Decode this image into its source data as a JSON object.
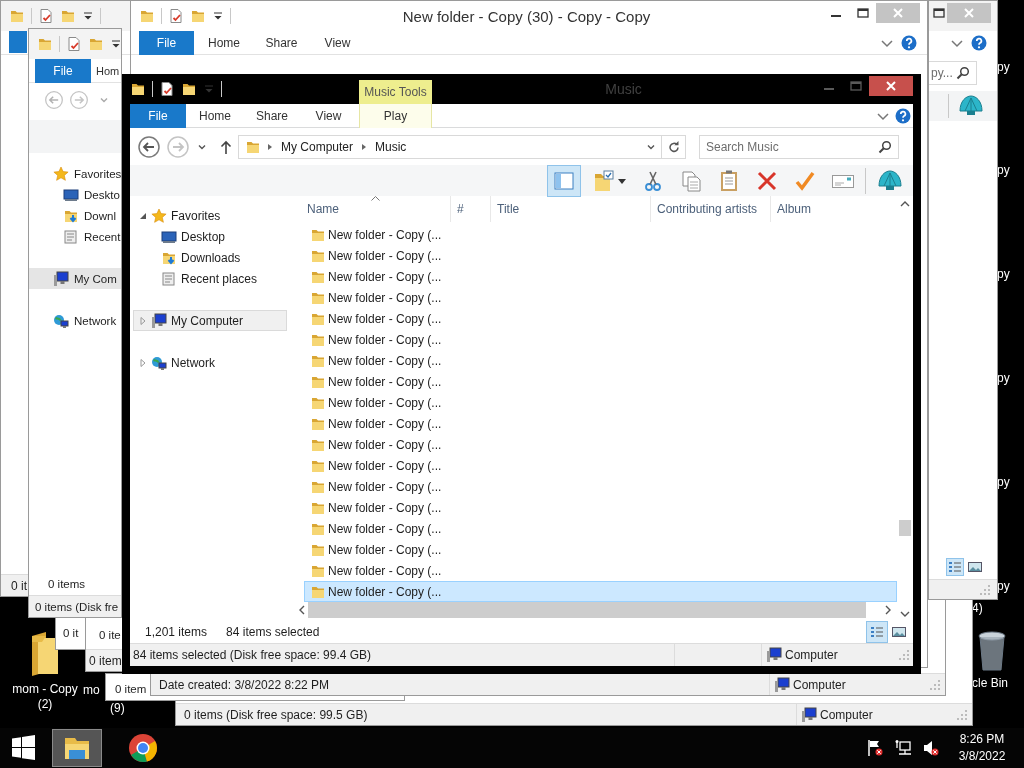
{
  "background_windows": [
    {
      "kind": "strip",
      "status": "0 it"
    },
    {
      "kind": "footer",
      "status": "0 items (Disk free space: 99.5 GB)",
      "location": "Computer"
    },
    {
      "kind": "footer",
      "body_text": "0 it"
    },
    {
      "kind": "footer",
      "body_text": "0 ite",
      "status": "0 item"
    },
    {
      "kind": "footer",
      "body_text": "0 item"
    },
    {
      "kind": "footer",
      "status": "Date created: 3/8/2022 8:22 PM",
      "location": "Computer"
    },
    {
      "kind": "explorer",
      "tabs": [
        "File",
        "Hom"
      ],
      "nav": [
        {
          "kind": "favorites",
          "label": "Favorites",
          "selected": false,
          "children": [
            {
              "kind": "desktop",
              "label": "Deskto",
              "selected": false
            },
            {
              "kind": "downloads",
              "label": "Downl",
              "selected": false
            },
            {
              "kind": "recent",
              "label": "Recent",
              "selected": false
            }
          ]
        },
        {
          "kind": "computer",
          "label": "My Com",
          "selected": true
        },
        {
          "kind": "network",
          "label": "Network",
          "selected": false
        }
      ],
      "count": "0 items",
      "status": "0 items (Disk fre"
    },
    {
      "kind": "edge",
      "search_placeholder": "py..."
    },
    {
      "kind": "titled",
      "title": "New folder - Copy (30) - Copy - Copy",
      "tabs": [
        "File",
        "Home",
        "Share",
        "View"
      ]
    }
  ],
  "window": {
    "title": "Music",
    "context_tab": "Music Tools",
    "tabs": [
      {
        "label": "File",
        "kind": "file"
      },
      {
        "label": "Home",
        "kind": "tab"
      },
      {
        "label": "Share",
        "kind": "tab"
      },
      {
        "label": "View",
        "kind": "tab"
      },
      {
        "label": "Play",
        "kind": "context"
      }
    ],
    "path": [
      "My Computer",
      "Music"
    ],
    "search_placeholder": "Search Music",
    "toolbar": [
      {
        "kind": "preview-pane",
        "selected": true
      },
      {
        "kind": "folder-menu",
        "selected": false
      },
      {
        "kind": "cut",
        "selected": false
      },
      {
        "kind": "copy",
        "selected": false
      },
      {
        "kind": "paste",
        "selected": false
      },
      {
        "kind": "delete",
        "selected": false
      },
      {
        "kind": "check",
        "selected": false
      },
      {
        "kind": "envelope",
        "selected": false
      },
      {
        "kind": "shell",
        "selected": false
      }
    ],
    "nav": [
      {
        "kind": "favorites",
        "label": "Favorites",
        "expanded": true,
        "selected": false,
        "children": [
          {
            "kind": "desktop",
            "label": "Desktop",
            "selected": false
          },
          {
            "kind": "downloads",
            "label": "Downloads",
            "selected": false
          },
          {
            "kind": "recent",
            "label": "Recent places",
            "selected": false
          }
        ]
      },
      {
        "kind": "computer",
        "label": "My Computer",
        "expanded": false,
        "selected": true
      },
      {
        "kind": "network",
        "label": "Network",
        "expanded": false,
        "selected": false
      }
    ],
    "columns": [
      {
        "label": "Name",
        "sorted": true
      },
      {
        "label": "#",
        "sorted": false
      },
      {
        "label": "Title",
        "sorted": false
      },
      {
        "label": "Contributing artists",
        "sorted": false
      },
      {
        "label": "Album",
        "sorted": false
      }
    ],
    "rows": [
      {
        "name": "New folder - Copy (...",
        "selected": false
      },
      {
        "name": "New folder - Copy (...",
        "selected": false
      },
      {
        "name": "New folder - Copy (...",
        "selected": false
      },
      {
        "name": "New folder - Copy (...",
        "selected": false
      },
      {
        "name": "New folder - Copy (...",
        "selected": false
      },
      {
        "name": "New folder - Copy (...",
        "selected": false
      },
      {
        "name": "New folder - Copy (...",
        "selected": false
      },
      {
        "name": "New folder - Copy (...",
        "selected": false
      },
      {
        "name": "New folder - Copy (...",
        "selected": false
      },
      {
        "name": "New folder - Copy (...",
        "selected": false
      },
      {
        "name": "New folder - Copy (...",
        "selected": false
      },
      {
        "name": "New folder - Copy (...",
        "selected": false
      },
      {
        "name": "New folder - Copy (...",
        "selected": false
      },
      {
        "name": "New folder - Copy (...",
        "selected": false
      },
      {
        "name": "New folder - Copy (...",
        "selected": false
      },
      {
        "name": "New folder - Copy (...",
        "selected": false
      },
      {
        "name": "New folder - Copy (...",
        "selected": false
      },
      {
        "name": "New folder - Copy (...",
        "selected": true
      }
    ],
    "item_count": "1,201 items",
    "selected_count": "84 items selected",
    "view_buttons": [
      {
        "kind": "details",
        "selected": true
      },
      {
        "kind": "large-icons",
        "selected": false
      }
    ],
    "status": "84 items selected (Disk free space: 99.4 GB)",
    "location": "Computer"
  },
  "desktop": {
    "icons": [
      {
        "kind": "folder",
        "label": "mom - Copy (2)"
      },
      {
        "kind": "recycle-bin",
        "label": "cle Bin"
      }
    ],
    "label_fragments": [
      "mo",
      "(9)",
      "4)",
      "py",
      "py",
      "py",
      "py",
      "py",
      "py"
    ]
  },
  "taskbar": {
    "apps": [
      {
        "kind": "explorer",
        "active": true
      },
      {
        "kind": "browser",
        "active": false
      }
    ],
    "tray": [
      {
        "kind": "flag"
      },
      {
        "kind": "network"
      },
      {
        "kind": "volume"
      }
    ],
    "time": "8:26 PM",
    "date": "3/8/2022"
  }
}
